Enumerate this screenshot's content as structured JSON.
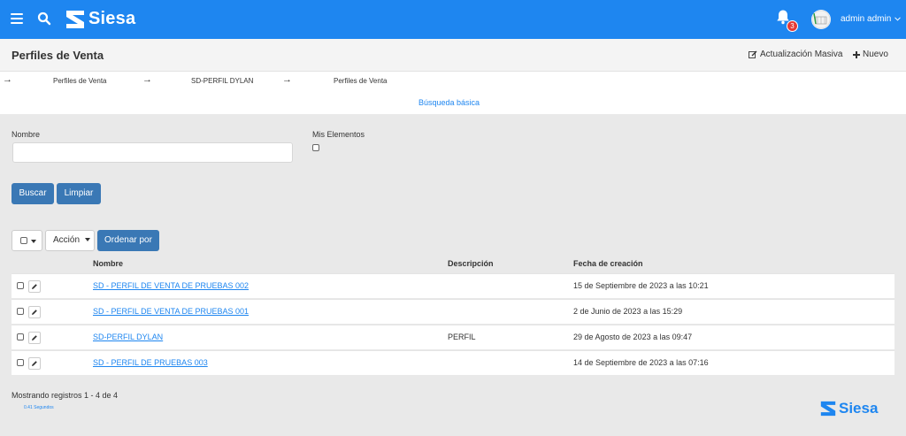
{
  "header": {
    "logo_text": "Siesa",
    "notification_count": "3",
    "user_name": "admin admin"
  },
  "titlebar": {
    "title": "Perfiles de Venta",
    "bulk_update_label": "Actualización Masiva",
    "new_label": "Nuevo"
  },
  "breadcrumb": [
    "Perfiles de Venta",
    "SD-PERFIL DYLAN",
    "Perfiles de Venta"
  ],
  "search": {
    "tab_label": "Búsqueda básica",
    "name_label": "Nombre",
    "name_value": "",
    "my_elements_label": "Mis Elementos",
    "search_button": "Buscar",
    "clear_button": "Limpiar"
  },
  "toolbar": {
    "action_label": "Acción",
    "sort_label": "Ordenar por"
  },
  "table": {
    "columns": [
      "Nombre",
      "Descripción",
      "Fecha de creación"
    ],
    "rows": [
      {
        "name": "SD - PERFIL DE VENTA DE PRUEBAS 002",
        "description": "",
        "date": "15 de Septiembre de 2023 a las 10:21"
      },
      {
        "name": "SD - PERFIL DE VENTA DE PRUEBAS 001",
        "description": "",
        "date": "2 de Junio de 2023 a las 15:29"
      },
      {
        "name": "SD-PERFIL DYLAN",
        "description": "PERFIL",
        "date": "29 de Agosto de 2023 a las 09:47"
      },
      {
        "name": "SD - PERFIL DE PRUEBAS 003",
        "description": "",
        "date": "14 de Septiembre de 2023 a las 07:16"
      }
    ]
  },
  "footer": {
    "records_text": "Mostrando registros 1 - 4 de 4",
    "time_text": "0.41 Segundos",
    "logo_text": "Siesa"
  },
  "colors": {
    "brand_blue": "#1e86f0",
    "button_blue": "#3a78b5",
    "badge_red": "#e53935"
  },
  "icons": [
    "menu-icon",
    "search-icon",
    "siesa-logo-icon",
    "bell-icon",
    "chevron-down-icon",
    "edit-icon",
    "plus-icon",
    "arrow-right-icon",
    "pencil-icon",
    "caret-down-icon"
  ]
}
